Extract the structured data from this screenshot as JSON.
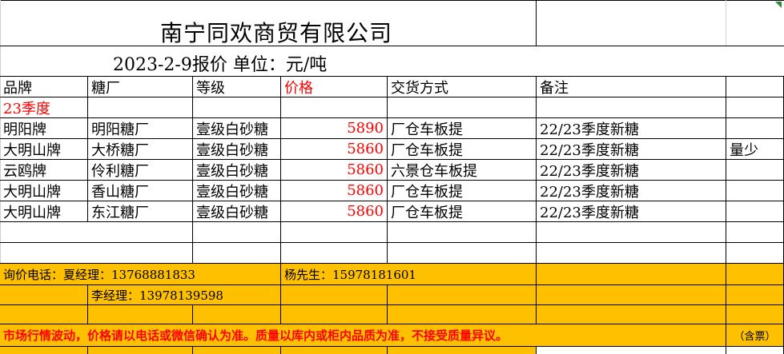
{
  "company_name": "南宁同欢商贸有限公司",
  "quote_line": "2023-2-9报价   单位：元/吨",
  "headers": {
    "brand": "品牌",
    "mill": "糖厂",
    "grade": "等级",
    "price": "价格",
    "delivery": "交货方式",
    "remark": "备注"
  },
  "season_label": "23季度",
  "rows": [
    {
      "brand": "明阳牌",
      "mill": "明阳糖厂",
      "grade": "壹级白砂糖",
      "price": "5890",
      "delivery": "厂仓车板提",
      "remark": "22/23季度新糖",
      "extra": ""
    },
    {
      "brand": "大明山牌",
      "mill": "大桥糖厂",
      "grade": "壹级白砂糖",
      "price": "5860",
      "delivery": "厂仓车板提",
      "remark": "22/23季度新糖",
      "extra": "量少"
    },
    {
      "brand": "云鸥牌",
      "mill": "伶利糖厂",
      "grade": "壹级白砂糖",
      "price": "5860",
      "delivery": "六景仓车板提",
      "remark": "22/23季度新糖",
      "extra": ""
    },
    {
      "brand": "大明山牌",
      "mill": "香山糖厂",
      "grade": "壹级白砂糖",
      "price": "5860",
      "delivery": "厂仓车板提",
      "remark": "22/23季度新糖",
      "extra": ""
    },
    {
      "brand": "大明山牌",
      "mill": "东江糖厂",
      "grade": "壹级白砂糖",
      "price": "5860",
      "delivery": "厂仓车板提",
      "remark": "22/23季度新糖",
      "extra": ""
    }
  ],
  "contacts": {
    "line1_left": "询价电话：夏经理：13768881833",
    "line1_right": "杨先生：15978181601",
    "line2": "李经理：13978139598"
  },
  "notice": "市场行情波动，价格请以电话或微信确认为准。质量以库内或柜内品质为准，不接受质量异议。",
  "tax_note": "（含票）",
  "colors": {
    "yellow_fill": "#ffc000",
    "red_text": "#ff0000",
    "corner_marker": "#2a8a3a"
  }
}
